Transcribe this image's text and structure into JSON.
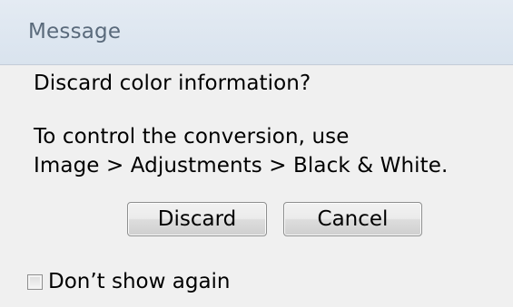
{
  "window": {
    "title": "Message"
  },
  "message": {
    "question": "Discard color information?",
    "detail_line1": "To control the conversion, use",
    "detail_line2": "Image > Adjustments > Black & White."
  },
  "buttons": {
    "discard_label": "Discard",
    "cancel_label": "Cancel"
  },
  "options": {
    "dont_show_again_label": "Don’t show again",
    "dont_show_again_checked": false
  }
}
